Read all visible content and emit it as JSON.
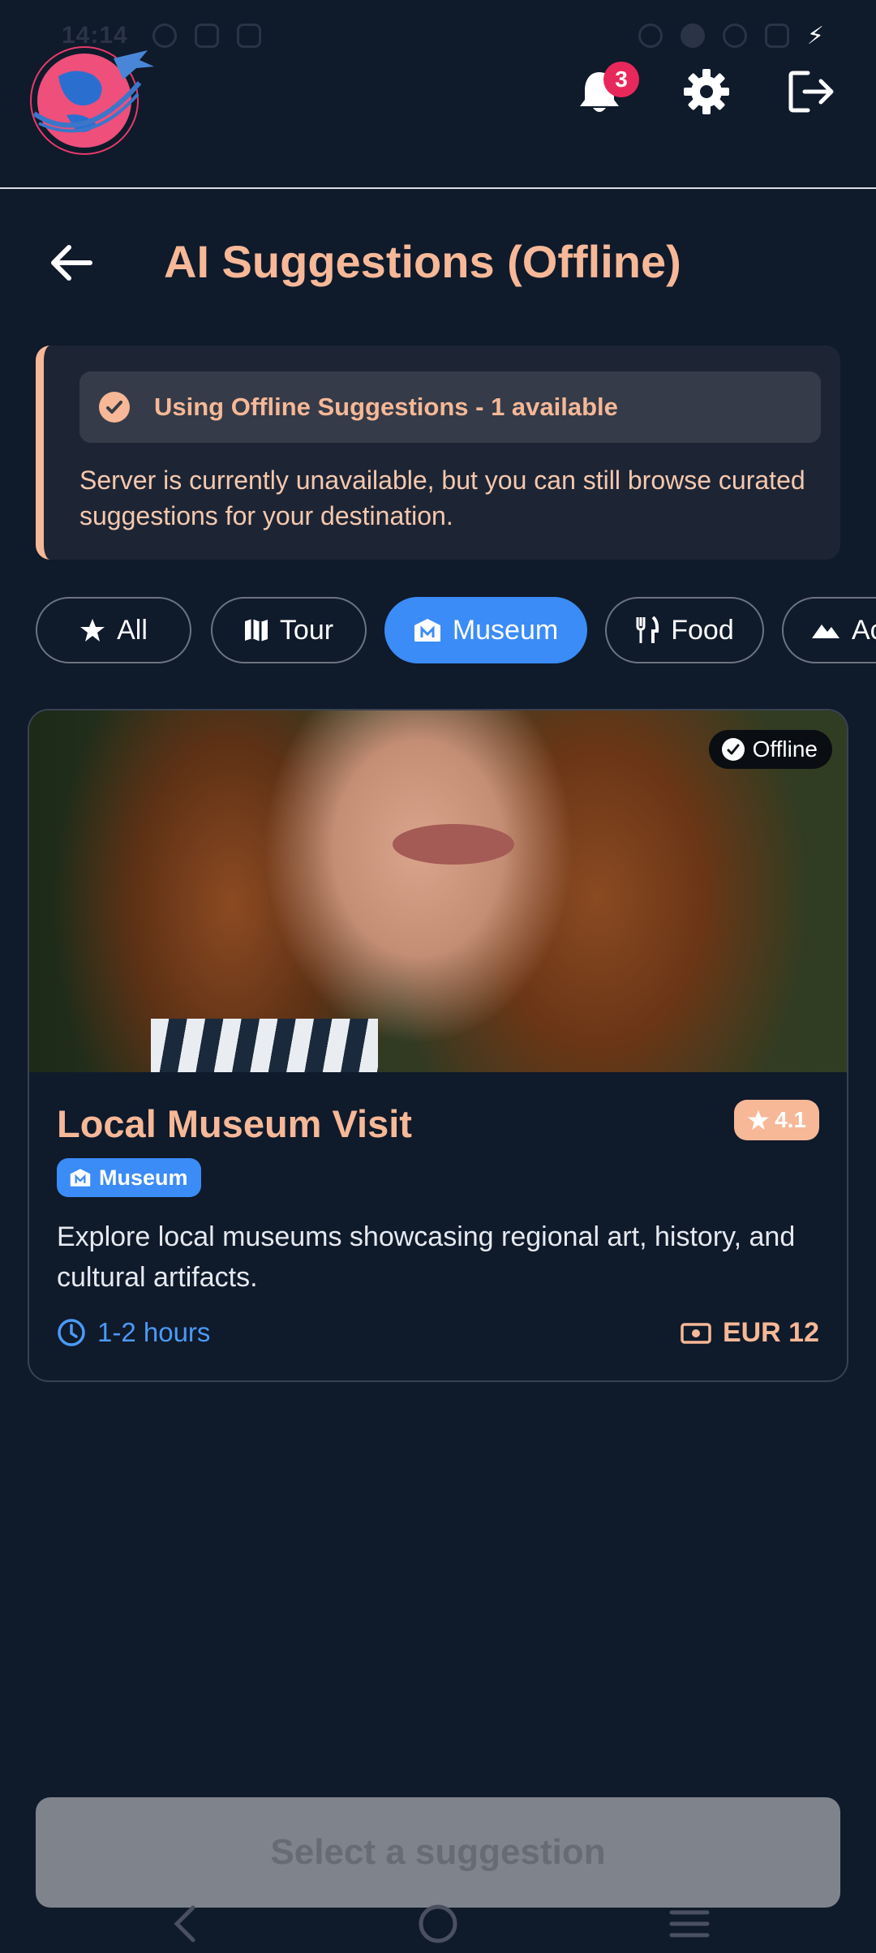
{
  "status_bar": {
    "time": "14:14"
  },
  "header": {
    "notification_count": "3"
  },
  "page": {
    "title": "AI Suggestions (Offline)"
  },
  "banner": {
    "heading": "Using Offline Suggestions - 1 available",
    "body": "Server is currently unavailable, but you can still browse curated suggestions for your destination."
  },
  "filters": [
    {
      "label": "All",
      "icon": "star-icon"
    },
    {
      "label": "Tour",
      "icon": "map-icon"
    },
    {
      "label": "Museum",
      "icon": "museum-icon",
      "selected": true
    },
    {
      "label": "Food",
      "icon": "fork-knife-icon"
    },
    {
      "label": "Ac",
      "icon": "mountain-icon"
    }
  ],
  "card": {
    "badge": "Offline",
    "title": "Local Museum Visit",
    "rating": "4.1",
    "category": "Museum",
    "description": "Explore local museums showcasing regional art, history, and cultural artifacts.",
    "duration": "1-2 hours",
    "price": "EUR 12"
  },
  "action": {
    "select_label": "Select a suggestion"
  },
  "colors": {
    "accent": "#f6b897",
    "primary": "#3b8cf6",
    "background": "#0f1a2b",
    "badge": "#e8285a"
  }
}
